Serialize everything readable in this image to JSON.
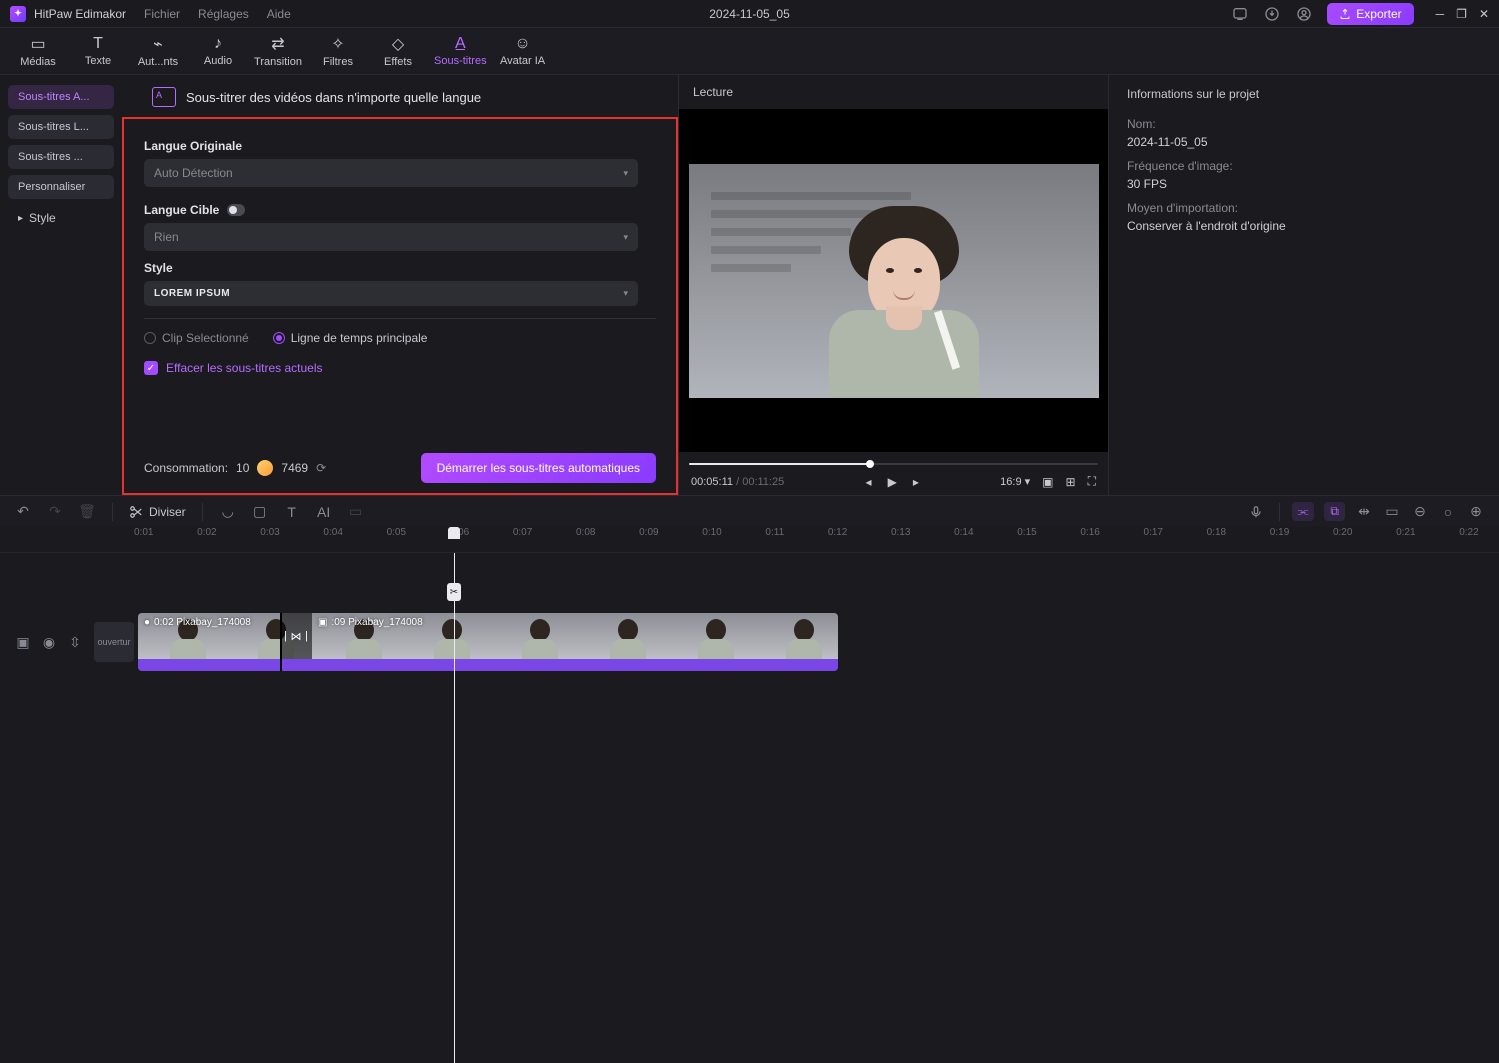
{
  "app": {
    "name": "HitPaw Edimakor"
  },
  "menu": {
    "file": "Fichier",
    "settings": "Réglages",
    "help": "Aide"
  },
  "project_title": "2024-11-05_05",
  "export_btn": "Exporter",
  "toptabs": {
    "media": "Médias",
    "text": "Texte",
    "auto": "Aut...nts",
    "audio": "Audio",
    "transition": "Transition",
    "filters": "Filtres",
    "effects": "Effets",
    "subtitles": "Sous-titres",
    "avatar": "Avatar IA"
  },
  "side_tabs": {
    "auto": "Sous-titres A...",
    "local": "Sous-titres L...",
    "other": "Sous-titres ...",
    "custom": "Personnaliser",
    "style": "Style"
  },
  "panel": {
    "title": "Sous-titrer des vidéos dans n'importe quelle langue",
    "orig_lang": "Langue Originale",
    "orig_value": "Auto Détection",
    "target_lang": "Langue Cible",
    "target_value": "Rien",
    "style_label": "Style",
    "style_value": "LOREM IPSUM",
    "radio_clip": "Clip Selectionné",
    "radio_main": "Ligne de temps principale",
    "checkbox": "Effacer les sous-titres actuels",
    "consumption_label": "Consommation:",
    "consumption_cost": "10",
    "credits": "7469",
    "start": "Démarrer les sous-titres automatiques"
  },
  "preview": {
    "label": "Lecture"
  },
  "player": {
    "current": "00:05:11",
    "duration": "00:11:25",
    "aspect": "16:9"
  },
  "info": {
    "title": "Informations sur le projet",
    "name_label": "Nom:",
    "name_value": "2024-11-05_05",
    "fps_label": "Fréquence d'image:",
    "fps_value": "30 FPS",
    "import_label": "Moyen d'importation:",
    "import_value": "Conserver à l'endroit d'origine"
  },
  "timeline": {
    "split": "Diviser",
    "intro": "ouvertur",
    "clip1": "0:02 Pixabay_174008",
    "clip2": ":09 Pixabay_174008",
    "ticks": [
      "0:01",
      "0:02",
      "0:03",
      "0:04",
      "0:05",
      "0:06",
      "0:07",
      "0:08",
      "0:09",
      "0:10",
      "0:11",
      "0:12",
      "0:13",
      "0:14",
      "0:15",
      "0:16",
      "0:17",
      "0:18",
      "0:19",
      "0:20",
      "0:21",
      "0:22"
    ]
  }
}
